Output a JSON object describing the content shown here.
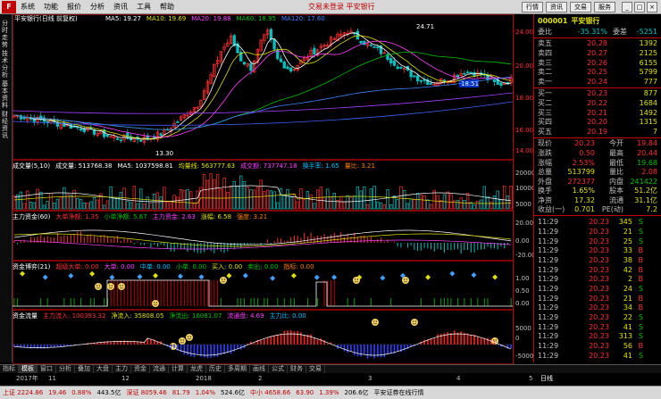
{
  "app": {
    "logo_text": "F",
    "menu": [
      "系统",
      "功能",
      "报价",
      "分析",
      "资讯",
      "工具",
      "帮助"
    ],
    "top_center": "交易未登录  平安银行",
    "top_buttons": [
      "行情",
      "资讯",
      "交易",
      "服务"
    ],
    "window_controls": [
      "_",
      "□",
      "×"
    ]
  },
  "left_tabs": [
    "分时走势",
    "技术分析",
    "基本资料",
    "财经资讯"
  ],
  "main_chart": {
    "title": "平安银行(日线 前复权)",
    "ma_labels": [
      {
        "text": "MA5: 19.27",
        "color": "#ffffff"
      },
      {
        "text": "MA10: 19.69",
        "color": "#e0e000"
      },
      {
        "text": "MA20: 19.88",
        "color": "#ff40ff"
      },
      {
        "text": "MA60: 18.95",
        "color": "#00c000"
      },
      {
        "text": "MA120: 17.60",
        "color": "#4080ff"
      }
    ],
    "price_ticks": [
      "20.00",
      "18.00",
      "16.00",
      "14.00"
    ],
    "top_tick": "24.00",
    "high_label": "24.71",
    "low_label": "13.30",
    "current_price_tag": "18.51"
  },
  "sub1": {
    "labels": [
      {
        "text": "成交量(5,10)",
        "color": "#ffffff"
      },
      {
        "text": "成交量: 513768.38",
        "color": "#ffffff"
      },
      {
        "text": "MA5: 1037598.81",
        "color": "#ffffff"
      },
      {
        "text": "均量线: 563777.63",
        "color": "#e0e000"
      },
      {
        "text": "成交额: 737747.18",
        "color": "#ff40ff"
      },
      {
        "text": "换手率: 1.65",
        "color": "#00c0ff"
      },
      {
        "text": "量比: 3.21",
        "color": "#ff8000"
      }
    ],
    "ticks": [
      "20000",
      "10000",
      "5000"
    ]
  },
  "sub2": {
    "labels": [
      {
        "text": "主力资金(60)",
        "color": "#ffffff"
      },
      {
        "text": "大单净额: 1.35",
        "color": "#ff3030"
      },
      {
        "text": "小单净额: 5.67",
        "color": "#00c000"
      },
      {
        "text": "主力资金: 2.63",
        "color": "#ff40ff"
      },
      {
        "text": "涨幅: 6.58",
        "color": "#e0e000"
      },
      {
        "text": "强度: 3.21",
        "color": "#ff8000"
      }
    ],
    "ticks": [
      "20.00",
      "0.00",
      "-20.00"
    ]
  },
  "sub3": {
    "labels": [
      {
        "text": "资金博弈(21)",
        "color": "#ffffff"
      },
      {
        "text": "超级大单: 0.00",
        "color": "#ff3030"
      },
      {
        "text": "大单: 0.00",
        "color": "#ff40ff"
      },
      {
        "text": "中单: 0.00",
        "color": "#00c0ff"
      },
      {
        "text": "小单: 0.00",
        "color": "#00c000"
      },
      {
        "text": "买入: 0.00",
        "color": "#e0e000"
      },
      {
        "text": "卖出: 0.00",
        "color": "#00c000"
      },
      {
        "text": "指标: 0.00",
        "color": "#ff8000"
      }
    ],
    "ticks": [
      "1.00",
      "0.50",
      "0.00"
    ]
  },
  "sub4": {
    "labels": [
      {
        "text": "资金流量",
        "color": "#ffffff"
      },
      {
        "text": "主力流入: 100393.32",
        "color": "#ff3030"
      },
      {
        "text": "净流入: 35808.05",
        "color": "#e0e000"
      },
      {
        "text": "净流出: 16081.07",
        "color": "#00c000"
      },
      {
        "text": "流通盘: 4.69",
        "color": "#ff40ff"
      },
      {
        "text": "主力比: 0.00",
        "color": "#00c0ff"
      }
    ],
    "ticks": [
      "5000",
      "0",
      "-5000"
    ]
  },
  "xaxis": {
    "labels": [
      "2017年",
      "11",
      "12",
      "2018",
      "2",
      "3",
      "4",
      "5"
    ],
    "right_label": "日线"
  },
  "bottom_tabs": [
    "指标",
    "模板",
    "窗口",
    "分析",
    "叠加",
    "大盘",
    "主力",
    "资金",
    "流通",
    "计算",
    "龙虎",
    "历史",
    "多周期",
    "画线",
    "公式",
    "财务",
    "交易"
  ],
  "bottom_tabs_active": 1,
  "statusbar": [
    {
      "text": "上证 2224.86",
      "color": "#c00000"
    },
    {
      "text": "19.46",
      "color": "#c00000"
    },
    {
      "text": "0.88%",
      "color": "#c00000"
    },
    {
      "text": "443.5亿",
      "color": "#000000"
    },
    {
      "text": "深证 8059.46",
      "color": "#c00000"
    },
    {
      "text": "81.79",
      "color": "#c00000"
    },
    {
      "text": "1.04%",
      "color": "#c00000"
    },
    {
      "text": "524.6亿",
      "color": "#000000"
    },
    {
      "text": "中小 4658.66",
      "color": "#c00000"
    },
    {
      "text": "63.90",
      "color": "#c00000"
    },
    {
      "text": "1.39%",
      "color": "#c00000"
    },
    {
      "text": "206.6亿",
      "color": "#000000"
    },
    {
      "text": "平安证券在线行情",
      "color": "#000000"
    }
  ],
  "quote": {
    "code": "000001",
    "name": "平安银行",
    "weibi_label": "委比",
    "weibi_value": "-35.31%",
    "weicha_label": "委差",
    "weicha_value": "-5251",
    "sell": [
      {
        "label": "卖五",
        "price": "20.28",
        "vol": "1392"
      },
      {
        "label": "卖四",
        "price": "20.27",
        "vol": "2125"
      },
      {
        "label": "卖三",
        "price": "20.26",
        "vol": "6155"
      },
      {
        "label": "卖二",
        "price": "20.25",
        "vol": "5799"
      },
      {
        "label": "卖一",
        "price": "20.24",
        "vol": "777"
      }
    ],
    "buy": [
      {
        "label": "买一",
        "price": "20.23",
        "vol": "877"
      },
      {
        "label": "买二",
        "price": "20.22",
        "vol": "1684"
      },
      {
        "label": "买三",
        "price": "20.21",
        "vol": "1492"
      },
      {
        "label": "买四",
        "price": "20.20",
        "vol": "1315"
      },
      {
        "label": "买五",
        "price": "20.19",
        "vol": "7"
      }
    ],
    "stats": [
      [
        "现价",
        "20.23",
        "今开",
        "19.84"
      ],
      [
        "涨跌",
        "0.50",
        "最高",
        "20.44"
      ],
      [
        "涨幅",
        "2.53%",
        "最低",
        "19.68"
      ],
      [
        "总量",
        "513799",
        "量比",
        "2.08"
      ],
      [
        "外盘",
        "272377",
        "内盘",
        "241422"
      ],
      [
        "换手",
        "1.65%",
        "股本",
        "51.2亿"
      ],
      [
        "净资",
        "17.32",
        "流通",
        "31.1亿"
      ],
      [
        "收益(一)",
        "0.701",
        "PE(动)",
        "7.2"
      ]
    ],
    "ticks": [
      [
        "11:29",
        "20.23",
        "345",
        "S"
      ],
      [
        "11:29",
        "20.23",
        "21",
        "S"
      ],
      [
        "11:29",
        "20.23",
        "25",
        "S"
      ],
      [
        "11:29",
        "20.23",
        "33",
        "B"
      ],
      [
        "11:29",
        "20.23",
        "38",
        "B"
      ],
      [
        "11:29",
        "20.23",
        "42",
        "B"
      ],
      [
        "11:29",
        "20.23",
        "2",
        "B"
      ],
      [
        "11:29",
        "20.23",
        "24",
        "S"
      ],
      [
        "11:29",
        "20.23",
        "21",
        "B"
      ],
      [
        "11:29",
        "20.23",
        "34",
        "B"
      ],
      [
        "11:29",
        "20.23",
        "22",
        "S"
      ],
      [
        "11:29",
        "20.23",
        "41",
        "S"
      ],
      [
        "11:29",
        "20.23",
        "313",
        "S"
      ],
      [
        "11:29",
        "20.23",
        "56",
        "B"
      ],
      [
        "11:29",
        "20.23",
        "41",
        "S"
      ]
    ]
  },
  "colors": {
    "up": "#ff3030",
    "down": "#00c0c0",
    "border": "#c00000",
    "vol_up": "#ff3030",
    "vol_down": "#00c0c0"
  }
}
